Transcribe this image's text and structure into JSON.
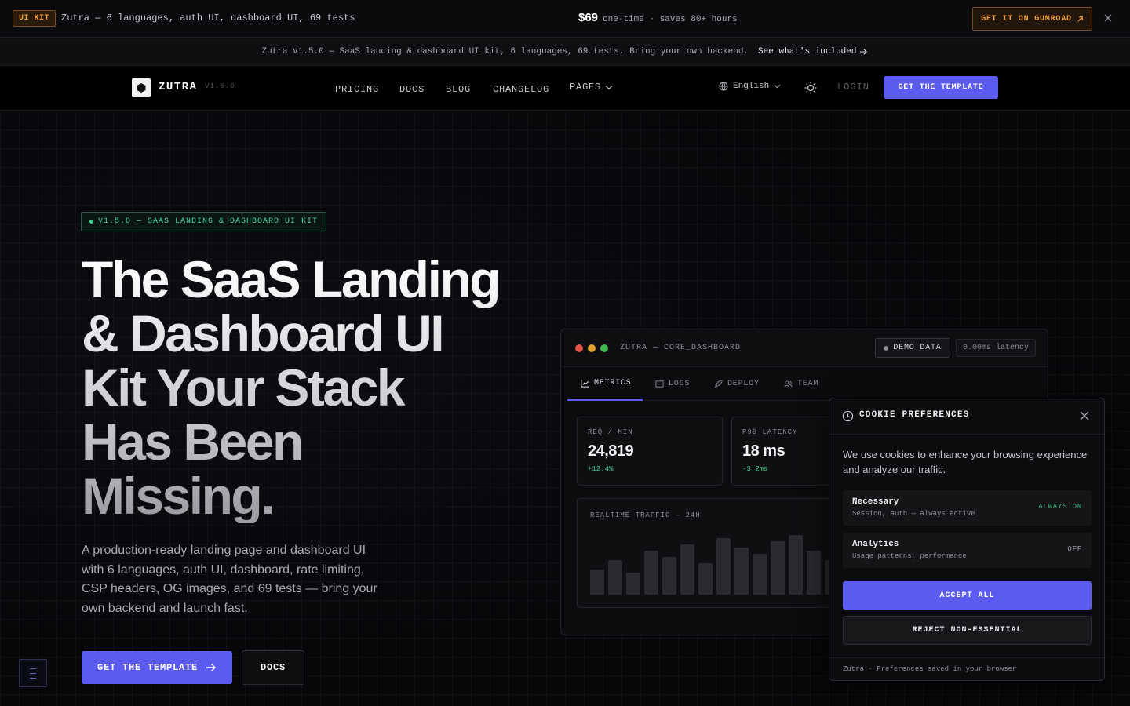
{
  "promo": {
    "badge": "UI KIT",
    "description": "Zutra — 6 languages, auth UI, dashboard UI, 69 tests",
    "price": "$69",
    "price_note": "one-time · saves 80+ hours",
    "cta": "GET IT ON GUMROAD",
    "cta_icon": "external-arrow-icon",
    "close_icon": "close-icon"
  },
  "announcement": {
    "text": "Zutra v1.5.0 — SaaS landing & dashboard UI kit, 6 languages, 69 tests. Bring your own backend.",
    "link": "See what's included",
    "link_icon": "arrow-right-icon"
  },
  "nav": {
    "brand": "ZUTRA",
    "version": "V1.5.0",
    "links": [
      "PRICING",
      "DOCS",
      "BLOG",
      "CHANGELOG"
    ],
    "pages": "PAGES",
    "language": "English",
    "login": "LOGIN",
    "cta": "GET THE TEMPLATE"
  },
  "hero": {
    "badge": "V1.5.0 — SAAS LANDING & DASHBOARD UI KIT",
    "title_lines": [
      "The SaaS Landing",
      "& Dashboard UI",
      "Kit Your Stack",
      "Has Been",
      "Missing."
    ],
    "subtitle": "A production-ready landing page and dashboard UI with 6 languages, auth UI, dashboard, rate limiting, CSP headers, OG images, and 69 tests — bring your own backend and launch fast.",
    "cta_primary": "GET THE TEMPLATE",
    "cta_secondary": "DOCS"
  },
  "dashboard": {
    "window_title": "ZUTRA — CORE_DASHBOARD",
    "demo_label": "DEMO DATA",
    "latency": "0.00ms latency",
    "tabs": [
      {
        "label": "METRICS",
        "icon": "chart-icon",
        "active": true
      },
      {
        "label": "LOGS",
        "icon": "terminal-icon",
        "active": false
      },
      {
        "label": "DEPLOY",
        "icon": "rocket-icon",
        "active": false
      },
      {
        "label": "TEAM",
        "icon": "users-icon",
        "active": false
      }
    ],
    "metrics": [
      {
        "label": "REQ / MIN",
        "value": "24,819",
        "change": "+12.4%"
      },
      {
        "label": "P99 LATENCY",
        "value": "18 ms",
        "change": "-3.2ms"
      }
    ],
    "traffic_label": "REALTIME TRAFFIC — 24H",
    "colors": {
      "dot_red": "#e5534b",
      "dot_yellow": "#e0a02a",
      "dot_green": "#3fb950",
      "accent": "#5b5bf0",
      "positive": "#3fcf8e"
    }
  },
  "chart_data": {
    "type": "bar",
    "title": "REALTIME TRAFFIC — 24H",
    "values": [
      32,
      44,
      28,
      56,
      48,
      64,
      40,
      72,
      60,
      52,
      68,
      76,
      56,
      44
    ],
    "ylim": [
      0,
      100
    ],
    "grid": false
  },
  "cookie": {
    "title": "COOKIE PREFERENCES",
    "title_icon": "clock-icon",
    "text": "We use cookies to enhance your browsing experience and analyze our traffic.",
    "prefs": [
      {
        "name": "Necessary",
        "desc": "Session, auth — always active",
        "state": "ALWAYS ON"
      },
      {
        "name": "Analytics",
        "desc": "Usage patterns, performance",
        "state": "OFF"
      }
    ],
    "accept": "ACCEPT ALL",
    "reject": "REJECT NON-ESSENTIAL",
    "footer": "Zutra · Preferences saved in your browser"
  }
}
